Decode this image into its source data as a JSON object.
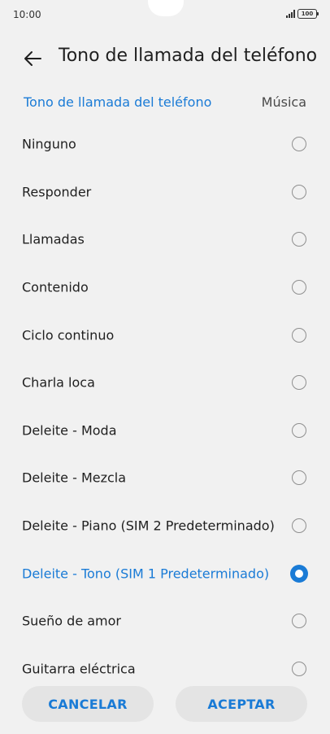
{
  "status_bar": {
    "time": "10:00",
    "battery": "100"
  },
  "header": {
    "title": "Tono de llamada del teléfono"
  },
  "tabs": [
    {
      "label": "Tono de llamada del teléfono",
      "active": true
    },
    {
      "label": "Música",
      "active": false
    }
  ],
  "ringtones": [
    {
      "label": "Ninguno",
      "selected": false
    },
    {
      "label": "Responder",
      "selected": false
    },
    {
      "label": "Llamadas",
      "selected": false
    },
    {
      "label": "Contenido",
      "selected": false
    },
    {
      "label": "Ciclo continuo",
      "selected": false
    },
    {
      "label": "Charla loca",
      "selected": false
    },
    {
      "label": "Deleite - Moda",
      "selected": false
    },
    {
      "label": "Deleite - Mezcla",
      "selected": false
    },
    {
      "label": "Deleite - Piano (SIM 2 Predeterminado)",
      "selected": false
    },
    {
      "label": "Deleite - Tono (SIM 1 Predeterminado)",
      "selected": true
    },
    {
      "label": "Sueño de amor",
      "selected": false
    },
    {
      "label": "Guitarra eléctrica",
      "selected": false
    }
  ],
  "buttons": {
    "cancel_label": "CANCELAR",
    "accept_label": "ACEPTAR"
  },
  "colors": {
    "accent": "#1a7bd6",
    "background": "#f1f1f1",
    "button_bg": "#e4e4e4"
  }
}
